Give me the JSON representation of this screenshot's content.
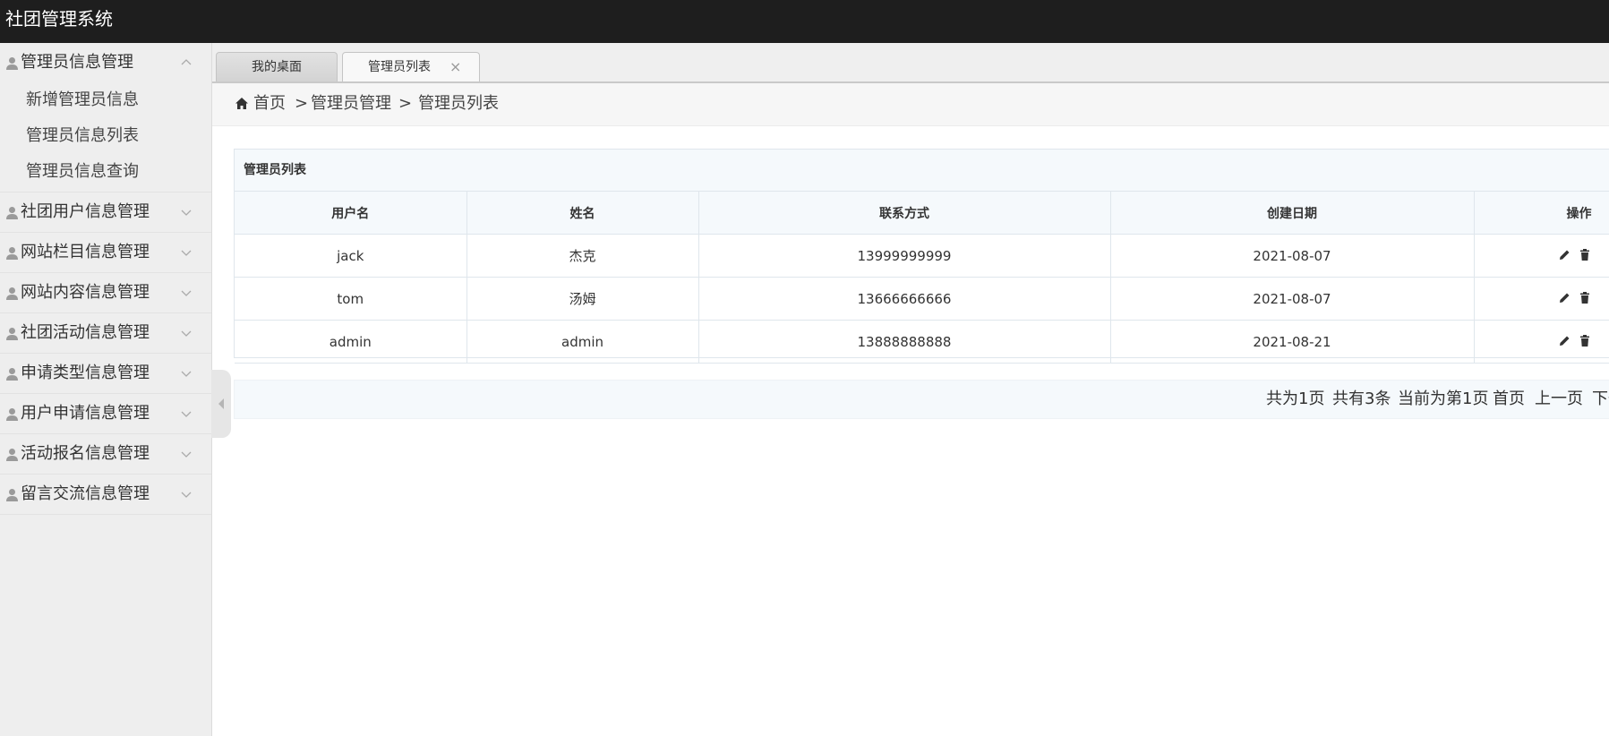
{
  "app": {
    "title": "社团管理系统"
  },
  "sidebar": {
    "groups": [
      {
        "label": "管理员信息管理",
        "expanded": true,
        "items": [
          "新增管理员信息",
          "管理员信息列表",
          "管理员信息查询"
        ]
      },
      {
        "label": "社团用户信息管理",
        "expanded": false
      },
      {
        "label": "网站栏目信息管理",
        "expanded": false
      },
      {
        "label": "网站内容信息管理",
        "expanded": false
      },
      {
        "label": "社团活动信息管理",
        "expanded": false
      },
      {
        "label": "申请类型信息管理",
        "expanded": false
      },
      {
        "label": "用户申请信息管理",
        "expanded": false
      },
      {
        "label": "活动报名信息管理",
        "expanded": false
      },
      {
        "label": "留言交流信息管理",
        "expanded": false
      }
    ]
  },
  "tabs": [
    {
      "label": "我的桌面",
      "active": false
    },
    {
      "label": "管理员列表",
      "active": true,
      "close": "×"
    }
  ],
  "breadcrumb": {
    "home": "首页",
    "separator": ">",
    "level1": "管理员管理",
    "level2": "管理员列表"
  },
  "panel": {
    "title": "管理员列表",
    "columns": [
      "用户名",
      "姓名",
      "联系方式",
      "创建日期",
      "操作"
    ],
    "rows": [
      {
        "username": "jack",
        "name": "杰克",
        "phone": "13999999999",
        "date": "2021-08-07"
      },
      {
        "username": "tom",
        "name": "汤姆",
        "phone": "13666666666",
        "date": "2021-08-07"
      },
      {
        "username": "admin",
        "name": "admin",
        "phone": "13888888888",
        "date": "2021-08-21"
      }
    ]
  },
  "pager": {
    "total_pages": "共为1页",
    "total_records": "共有3条",
    "current_page": "当前为第1页",
    "first": "首页",
    "prev": "上一页",
    "next": "下一"
  },
  "colors": {
    "topbar": "#1e1e1e",
    "sidebar": "#eeeeee",
    "header_bg": "#f5f9fc",
    "border": "#dfe6ec"
  }
}
